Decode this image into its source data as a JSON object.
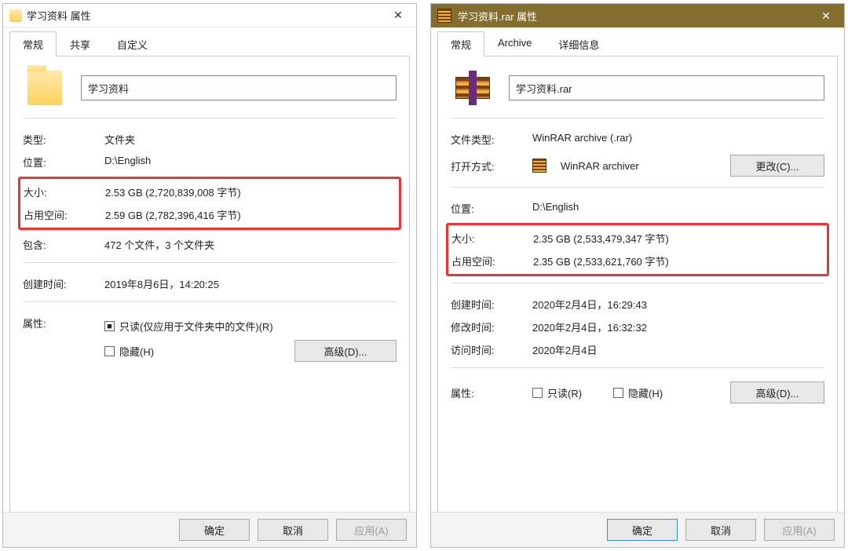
{
  "left": {
    "title": "学习资料 属性",
    "tabs": [
      "常规",
      "共享",
      "自定义"
    ],
    "name": "学习资料",
    "type_label": "类型:",
    "type_value": "文件夹",
    "location_label": "位置:",
    "location_value": "D:\\English",
    "size_label": "大小:",
    "size_value": "2.53 GB (2,720,839,008 字节)",
    "disk_label": "占用空间:",
    "disk_value": "2.59 GB (2,782,396,416 字节)",
    "contains_label": "包含:",
    "contains_value": "472 个文件，3 个文件夹",
    "created_label": "创建时间:",
    "created_value": "2019年8月6日，14:20:25",
    "attr_label": "属性:",
    "readonly_label": "只读(仅应用于文件夹中的文件)(R)",
    "hidden_label": "隐藏(H)",
    "advanced_btn": "高级(D)...",
    "ok_btn": "确定",
    "cancel_btn": "取消",
    "apply_btn": "应用(A)"
  },
  "right": {
    "title": "学习资料.rar 属性",
    "tabs": [
      "常规",
      "Archive",
      "详细信息"
    ],
    "name": "学习资料.rar",
    "filetype_label": "文件类型:",
    "filetype_value": "WinRAR archive (.rar)",
    "openwith_label": "打开方式:",
    "openwith_value": "WinRAR archiver",
    "change_btn": "更改(C)...",
    "location_label": "位置:",
    "location_value": "D:\\English",
    "size_label": "大小:",
    "size_value": "2.35 GB (2,533,479,347 字节)",
    "disk_label": "占用空间:",
    "disk_value": "2.35 GB (2,533,621,760 字节)",
    "created_label": "创建时间:",
    "created_value": "2020年2月4日，16:29:43",
    "modified_label": "修改时间:",
    "modified_value": "2020年2月4日，16:32:32",
    "accessed_label": "访问时间:",
    "accessed_value": "2020年2月4日",
    "attr_label": "属性:",
    "readonly_label": "只读(R)",
    "hidden_label": "隐藏(H)",
    "advanced_btn": "高级(D)...",
    "ok_btn": "确定",
    "cancel_btn": "取消",
    "apply_btn": "应用(A)"
  }
}
